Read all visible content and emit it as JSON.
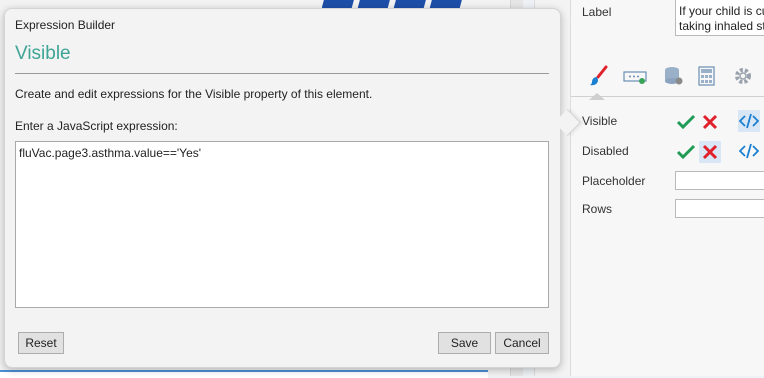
{
  "popup": {
    "header": "Expression Builder",
    "title": "Visible",
    "description": "Create and edit expressions for the Visible property of this element.",
    "prompt": "Enter a JavaScript expression:",
    "expression": "fluVac.page3.asthma.value=='Yes'",
    "buttons": {
      "reset": "Reset",
      "save": "Save",
      "cancel": "Cancel"
    }
  },
  "properties": {
    "label": {
      "name": "Label",
      "value_line1": "If your child is cu",
      "value_line2": "taking inhaled st"
    },
    "tabs": [
      "brush-icon",
      "textbox-icon",
      "database-icon",
      "calculator-icon",
      "gear-icon"
    ],
    "rows": [
      {
        "name": "Visible"
      },
      {
        "name": "Disabled"
      },
      {
        "name": "Placeholder"
      },
      {
        "name": "Rows"
      }
    ]
  },
  "colors": {
    "accent": "#3ea496",
    "check": "#1f9b55",
    "cross": "#e0202a",
    "code": "#1a7fd1"
  }
}
